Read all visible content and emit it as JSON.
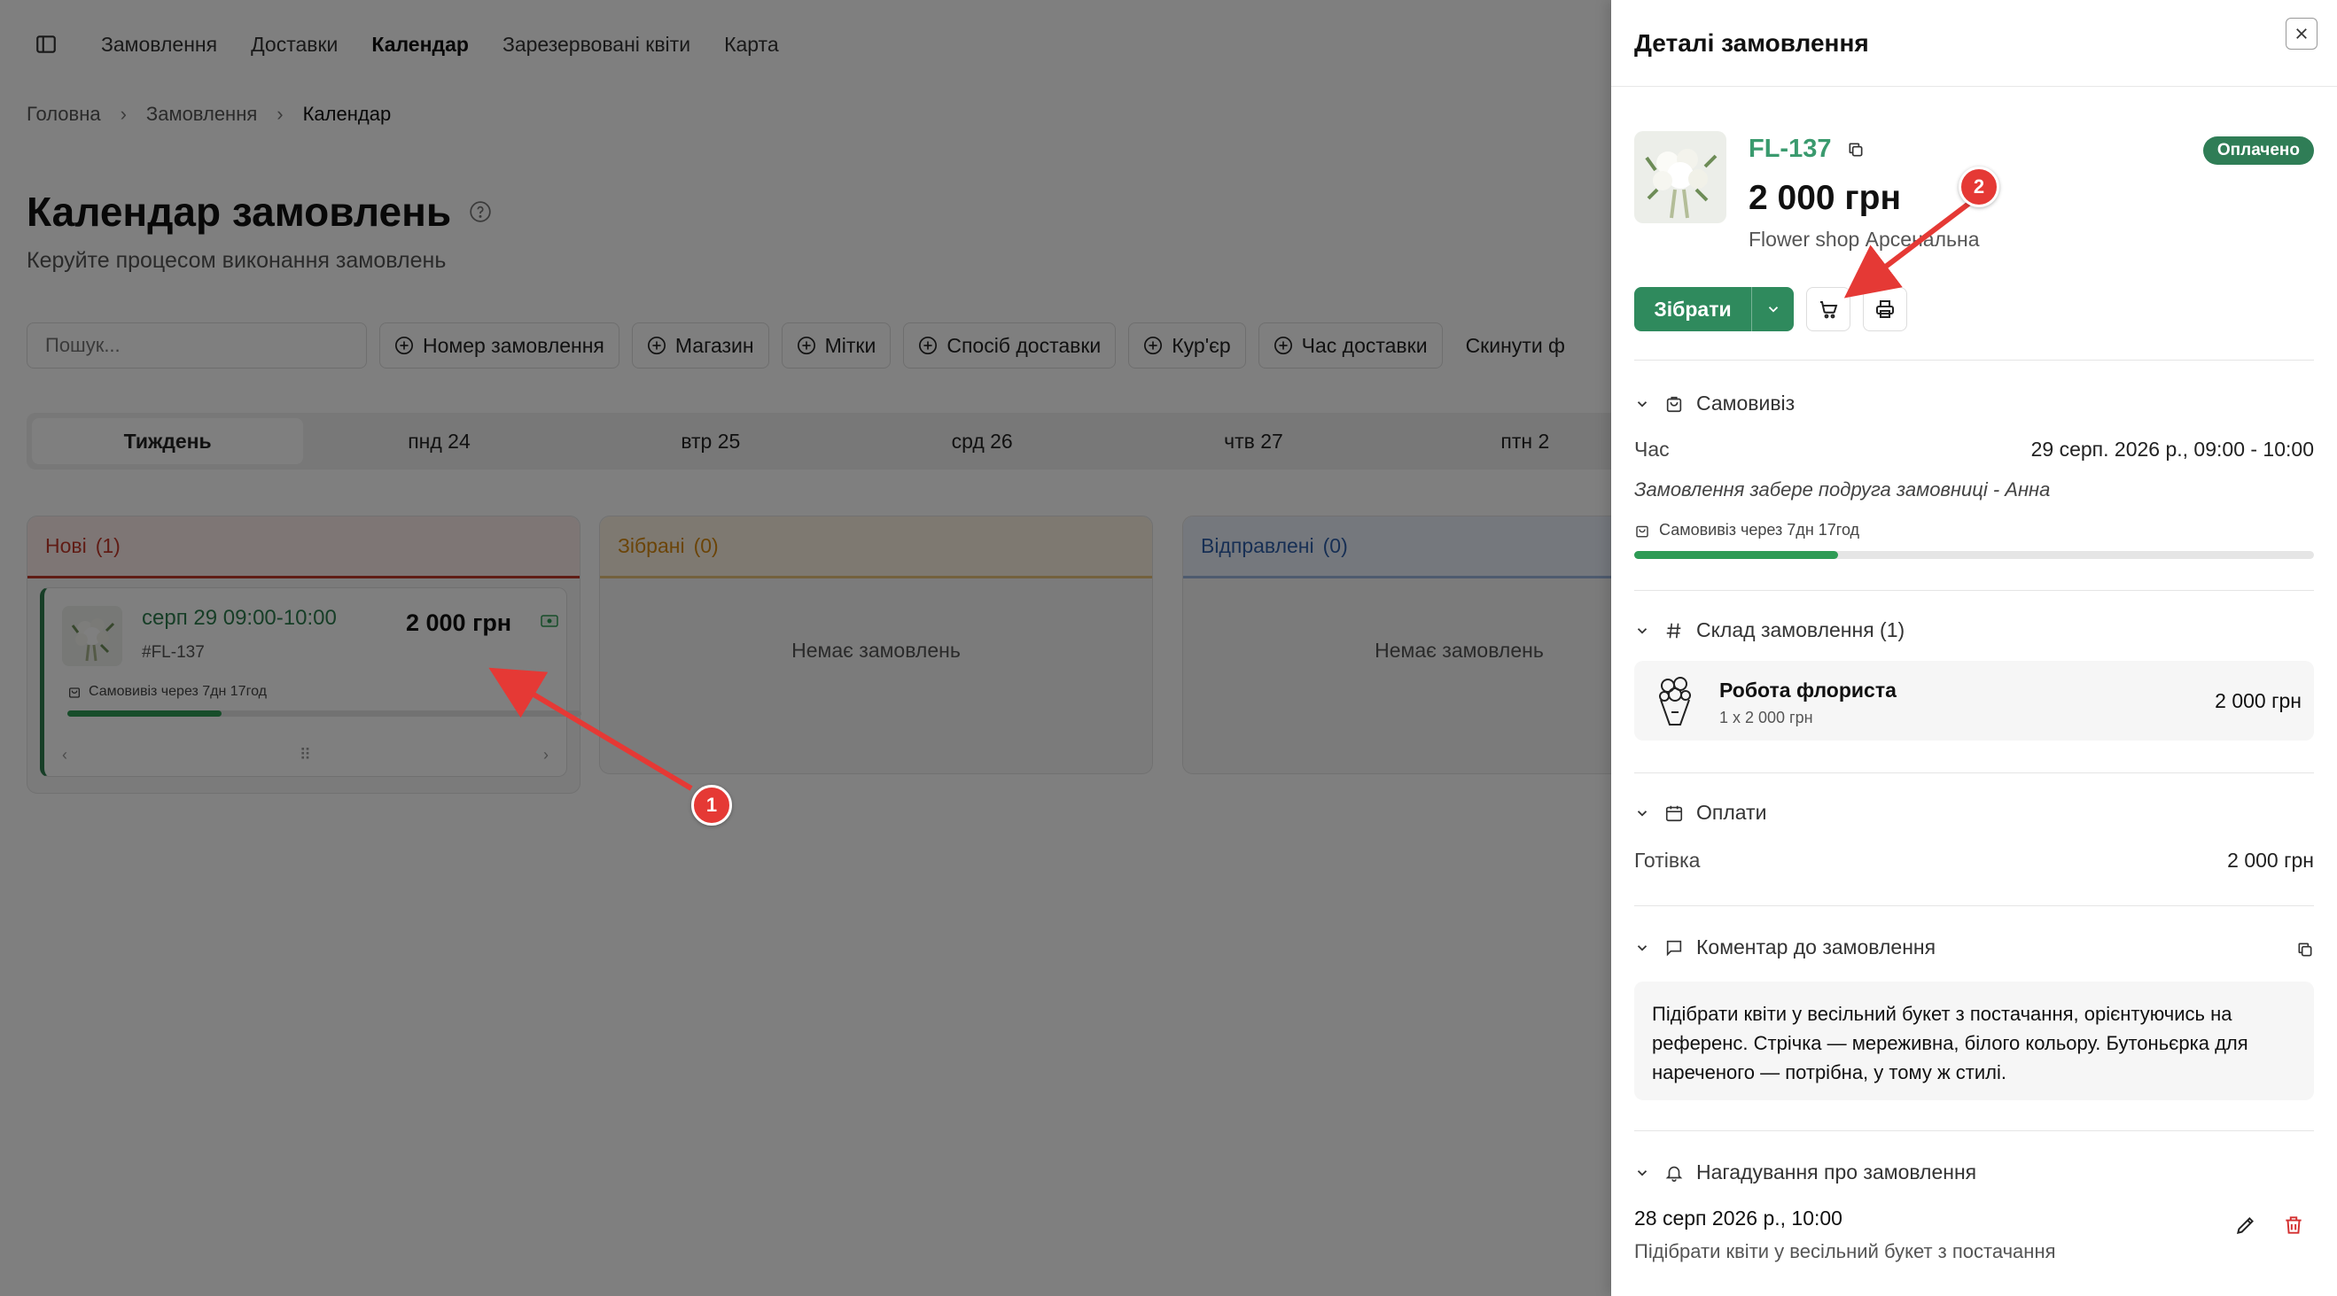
{
  "nav": {
    "items": [
      "Замовлення",
      "Доставки",
      "Календар",
      "Зарезервовані квіти",
      "Карта"
    ],
    "active": 2
  },
  "breadcrumb": [
    "Головна",
    "Замовлення",
    "Календар"
  ],
  "page": {
    "title": "Календар замовлень",
    "subtitle": "Керуйте процесом виконання замовлень"
  },
  "filters": {
    "search_placeholder": "Пошук...",
    "buttons": [
      "Номер замовлення",
      "Магазин",
      "Мітки",
      "Спосіб доставки",
      "Кур'єр",
      "Час доставки"
    ],
    "reset": "Скинути ф"
  },
  "week_tabs": [
    "Тиждень",
    "пнд 24",
    "втр 25",
    "срд 26",
    "чтв 27",
    "птн 2"
  ],
  "columns": [
    {
      "name": "Нові",
      "count": "(1)",
      "color": "#c0392b"
    },
    {
      "name": "Зібрані",
      "count": "(0)",
      "color": "#d68910",
      "empty": "Немає замовлень"
    },
    {
      "name": "Відправлені",
      "count": "(0)",
      "color": "#2e5fa8",
      "empty": "Немає замовлень"
    }
  ],
  "order_card": {
    "time": "серп 29 09:00-10:00",
    "price": "2 000 грн",
    "number": "#FL-137",
    "pickup": "Самовивіз через 7дн 17год",
    "progress": 0.3
  },
  "callouts": {
    "one": "1",
    "two": "2"
  },
  "panel": {
    "title": "Деталі замовлення",
    "order_no": "FL-137",
    "amount": "2 000 грн",
    "shop": "Flower shop Арсенальна",
    "status": "Оплачено",
    "collect_label": "Зібрати",
    "pickup": {
      "title": "Самовивіз",
      "time_label": "Час",
      "time_value": "29 серп. 2026 р., 09:00 - 10:00",
      "note": "Замовлення забере подруга замовниці - Анна",
      "countdown": "Самовивіз через 7дн 17год",
      "progress": 0.3
    },
    "items": {
      "title": "Склад замовлення (1)",
      "list": [
        {
          "name": "Робота флориста",
          "qty": "1 x 2 000 грн",
          "price": "2 000 грн"
        }
      ]
    },
    "payments": {
      "title": "Оплати",
      "method": "Готівка",
      "amount": "2 000 грн"
    },
    "comment": {
      "title": "Коментар до замовлення",
      "text": "Підібрати квіти у весільний букет з постачання, орієнтуючись на референс. Стрічка — мереживна, білого кольору. Бутоньєрка для нареченого — потрібна, у тому ж стилі."
    },
    "reminder": {
      "title": "Нагадування про замовлення",
      "date": "28 серп 2026 р., 10:00",
      "text": "Підібрати квіти у весільний букет з постачання"
    }
  }
}
